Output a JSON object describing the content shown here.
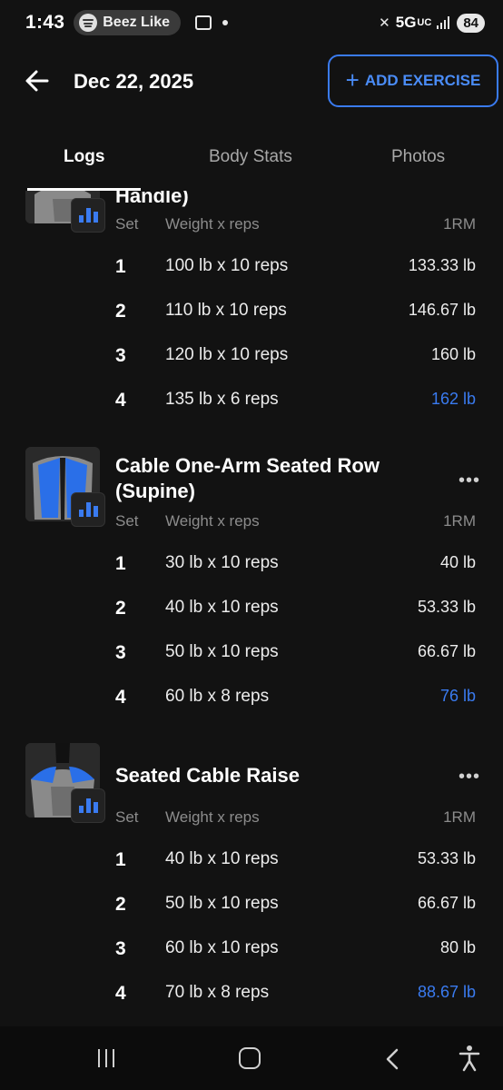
{
  "status_bar": {
    "time": "1:43",
    "now_playing": "Beez Like",
    "network": "5G",
    "network_sub": "UC",
    "battery": "84"
  },
  "header": {
    "date": "Dec 22, 2025",
    "add_exercise_label": "ADD EXERCISE",
    "accent_color": "#3a7bf0"
  },
  "tabs": [
    {
      "label": "Logs",
      "active": true
    },
    {
      "label": "Body Stats",
      "active": false
    },
    {
      "label": "Photos",
      "active": false
    }
  ],
  "columns": {
    "set": "Set",
    "weight_reps": "Weight x reps",
    "one_rm": "1RM"
  },
  "exercises": [
    {
      "title": "Handle)",
      "sets": [
        {
          "set": "1",
          "weight_reps": "100 lb x 10 reps",
          "one_rm": "133.33 lb",
          "pr": false
        },
        {
          "set": "2",
          "weight_reps": "110 lb x 10 reps",
          "one_rm": "146.67 lb",
          "pr": false
        },
        {
          "set": "3",
          "weight_reps": "120 lb x 10 reps",
          "one_rm": "160 lb",
          "pr": false
        },
        {
          "set": "4",
          "weight_reps": "135 lb x 6 reps",
          "one_rm": "162 lb",
          "pr": true
        }
      ]
    },
    {
      "title": "Cable One-Arm Seated Row (Supine)",
      "sets": [
        {
          "set": "1",
          "weight_reps": "30 lb x 10 reps",
          "one_rm": "40 lb",
          "pr": false
        },
        {
          "set": "2",
          "weight_reps": "40 lb x 10 reps",
          "one_rm": "53.33 lb",
          "pr": false
        },
        {
          "set": "3",
          "weight_reps": "50 lb x 10 reps",
          "one_rm": "66.67 lb",
          "pr": false
        },
        {
          "set": "4",
          "weight_reps": "60 lb x 8 reps",
          "one_rm": "76 lb",
          "pr": true
        }
      ]
    },
    {
      "title": "Seated Cable Raise",
      "sets": [
        {
          "set": "1",
          "weight_reps": "40 lb x 10 reps",
          "one_rm": "53.33 lb",
          "pr": false
        },
        {
          "set": "2",
          "weight_reps": "50 lb x 10 reps",
          "one_rm": "66.67 lb",
          "pr": false
        },
        {
          "set": "3",
          "weight_reps": "60 lb x 10 reps",
          "one_rm": "80 lb",
          "pr": false
        },
        {
          "set": "4",
          "weight_reps": "70 lb x 8 reps",
          "one_rm": "88.67 lb",
          "pr": true
        }
      ]
    }
  ]
}
